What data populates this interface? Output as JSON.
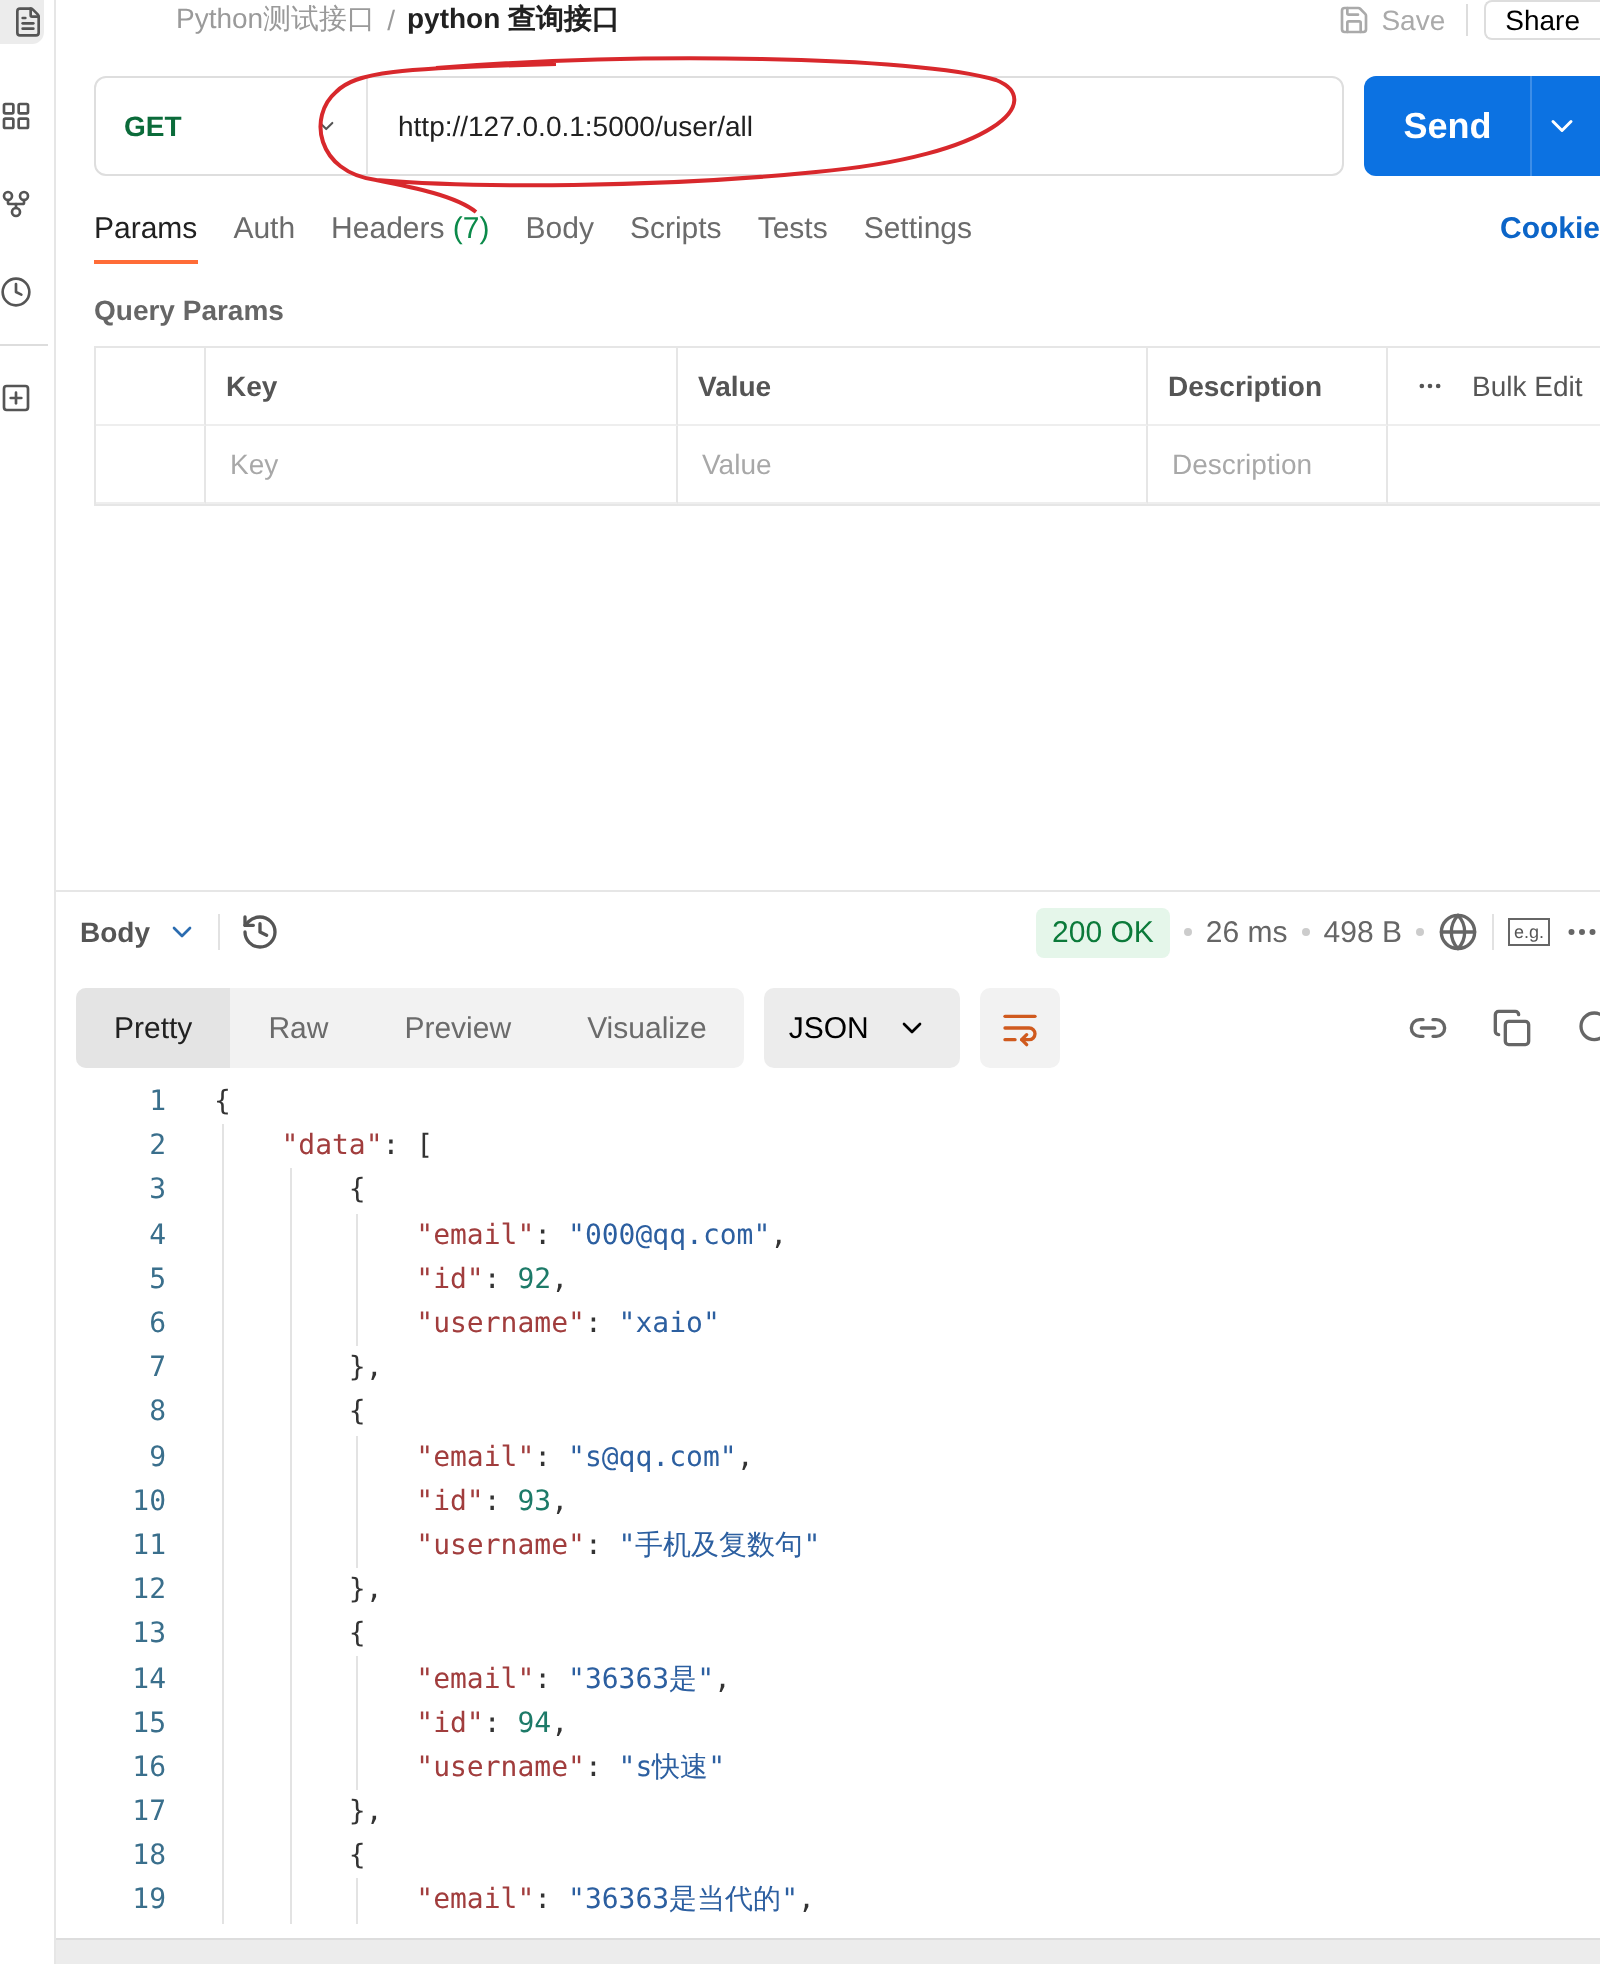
{
  "breadcrumb": {
    "collection": "Python测试接口",
    "separator": "/",
    "request": "python 查询接口"
  },
  "top_actions": {
    "save": "Save",
    "share": "Share"
  },
  "request": {
    "method": "GET",
    "url": "http://127.0.0.1:5000/user/all",
    "send": "Send"
  },
  "request_tabs": [
    {
      "label": "Params",
      "selected": true
    },
    {
      "label": "Auth",
      "selected": false
    },
    {
      "label": "Headers",
      "count": "(7)",
      "selected": false
    },
    {
      "label": "Body",
      "selected": false
    },
    {
      "label": "Scripts",
      "selected": false
    },
    {
      "label": "Tests",
      "selected": false
    },
    {
      "label": "Settings",
      "selected": false
    }
  ],
  "cookies_link": "Cookie",
  "query_params": {
    "title": "Query Params",
    "columns": [
      "Key",
      "Value",
      "Description"
    ],
    "bulk_edit": "Bulk Edit",
    "placeholders": [
      "Key",
      "Value",
      "Description"
    ]
  },
  "response": {
    "section": "Body",
    "status": "200 OK",
    "time": "26 ms",
    "size": "498 B",
    "example_label": "e.g.",
    "view_tabs": [
      {
        "label": "Pretty",
        "selected": true
      },
      {
        "label": "Raw",
        "selected": false
      },
      {
        "label": "Preview",
        "selected": false
      },
      {
        "label": "Visualize",
        "selected": false
      }
    ],
    "format": "JSON"
  },
  "annotation": {
    "kind": "ellipse",
    "color": "#d8282c"
  },
  "code_lines": [
    {
      "number": "1",
      "tokens": [
        {
          "kind": "punct",
          "text": "{"
        }
      ]
    },
    {
      "number": "2",
      "tokens": [
        {
          "kind": "key",
          "text": "    \"data\""
        },
        {
          "kind": "punct",
          "text": ": ["
        }
      ]
    },
    {
      "number": "3",
      "tokens": [
        {
          "kind": "punct",
          "text": "        {"
        }
      ]
    },
    {
      "number": "4",
      "tokens": [
        {
          "kind": "key",
          "text": "            \"email\""
        },
        {
          "kind": "punct",
          "text": ": "
        },
        {
          "kind": "string",
          "text": "\"000@qq.com\""
        },
        {
          "kind": "punct",
          "text": ","
        }
      ]
    },
    {
      "number": "5",
      "tokens": [
        {
          "kind": "key",
          "text": "            \"id\""
        },
        {
          "kind": "punct",
          "text": ": "
        },
        {
          "kind": "number",
          "text": "92"
        },
        {
          "kind": "punct",
          "text": ","
        }
      ]
    },
    {
      "number": "6",
      "tokens": [
        {
          "kind": "key",
          "text": "            \"username\""
        },
        {
          "kind": "punct",
          "text": ": "
        },
        {
          "kind": "string",
          "text": "\"xaio\""
        }
      ]
    },
    {
      "number": "7",
      "tokens": [
        {
          "kind": "punct",
          "text": "        },"
        }
      ]
    },
    {
      "number": "8",
      "tokens": [
        {
          "kind": "punct",
          "text": "        {"
        }
      ]
    },
    {
      "number": "9",
      "tokens": [
        {
          "kind": "key",
          "text": "            \"email\""
        },
        {
          "kind": "punct",
          "text": ": "
        },
        {
          "kind": "string",
          "text": "\"s@qq.com\""
        },
        {
          "kind": "punct",
          "text": ","
        }
      ]
    },
    {
      "number": "10",
      "tokens": [
        {
          "kind": "key",
          "text": "            \"id\""
        },
        {
          "kind": "punct",
          "text": ": "
        },
        {
          "kind": "number",
          "text": "93"
        },
        {
          "kind": "punct",
          "text": ","
        }
      ]
    },
    {
      "number": "11",
      "tokens": [
        {
          "kind": "key",
          "text": "            \"username\""
        },
        {
          "kind": "punct",
          "text": ": "
        },
        {
          "kind": "string",
          "text": "\"手机及复数句\""
        }
      ]
    },
    {
      "number": "12",
      "tokens": [
        {
          "kind": "punct",
          "text": "        },"
        }
      ]
    },
    {
      "number": "13",
      "tokens": [
        {
          "kind": "punct",
          "text": "        {"
        }
      ]
    },
    {
      "number": "14",
      "tokens": [
        {
          "kind": "key",
          "text": "            \"email\""
        },
        {
          "kind": "punct",
          "text": ": "
        },
        {
          "kind": "string",
          "text": "\"36363是\""
        },
        {
          "kind": "punct",
          "text": ","
        }
      ]
    },
    {
      "number": "15",
      "tokens": [
        {
          "kind": "key",
          "text": "            \"id\""
        },
        {
          "kind": "punct",
          "text": ": "
        },
        {
          "kind": "number",
          "text": "94"
        },
        {
          "kind": "punct",
          "text": ","
        }
      ]
    },
    {
      "number": "16",
      "tokens": [
        {
          "kind": "key",
          "text": "            \"username\""
        },
        {
          "kind": "punct",
          "text": ": "
        },
        {
          "kind": "string",
          "text": "\"s快速\""
        }
      ]
    },
    {
      "number": "17",
      "tokens": [
        {
          "kind": "punct",
          "text": "        },"
        }
      ]
    },
    {
      "number": "18",
      "tokens": [
        {
          "kind": "punct",
          "text": "        {"
        }
      ]
    },
    {
      "number": "19",
      "tokens": [
        {
          "kind": "key",
          "text": "            \"email\""
        },
        {
          "kind": "punct",
          "text": ": "
        },
        {
          "kind": "string",
          "text": "\"36363是当代的\""
        },
        {
          "kind": "punct",
          "text": ","
        }
      ]
    }
  ]
}
